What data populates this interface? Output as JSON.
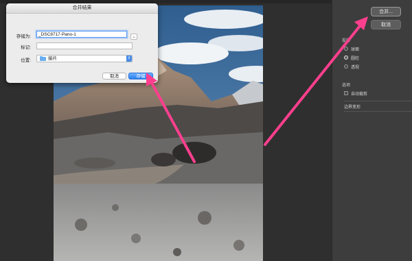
{
  "dialog": {
    "title": "合并结果",
    "save_as_label": "存储为:",
    "filename_value": "_DSC8717-Pano-1",
    "tags_label": "标记:",
    "tags_value": "",
    "location_label": "位置:",
    "location_value": "接片",
    "expand_icon": "chevron-down-icon",
    "cancel_label": "取消",
    "save_label": "存储"
  },
  "panel": {
    "merge_label": "合并...",
    "cancel_label": "取消",
    "projection_header": "投影",
    "projections": [
      {
        "label": "球面",
        "selected": false
      },
      {
        "label": "圆柱",
        "selected": true
      },
      {
        "label": "透视",
        "selected": false
      }
    ],
    "options_header": "选项",
    "auto_crop_label": "自动裁剪",
    "auto_crop_checked": false,
    "boundary_warp_label": "边界变形"
  },
  "colors": {
    "annotation_arrow": "#ff3f8e",
    "accent_blue": "#2c7ff0"
  }
}
